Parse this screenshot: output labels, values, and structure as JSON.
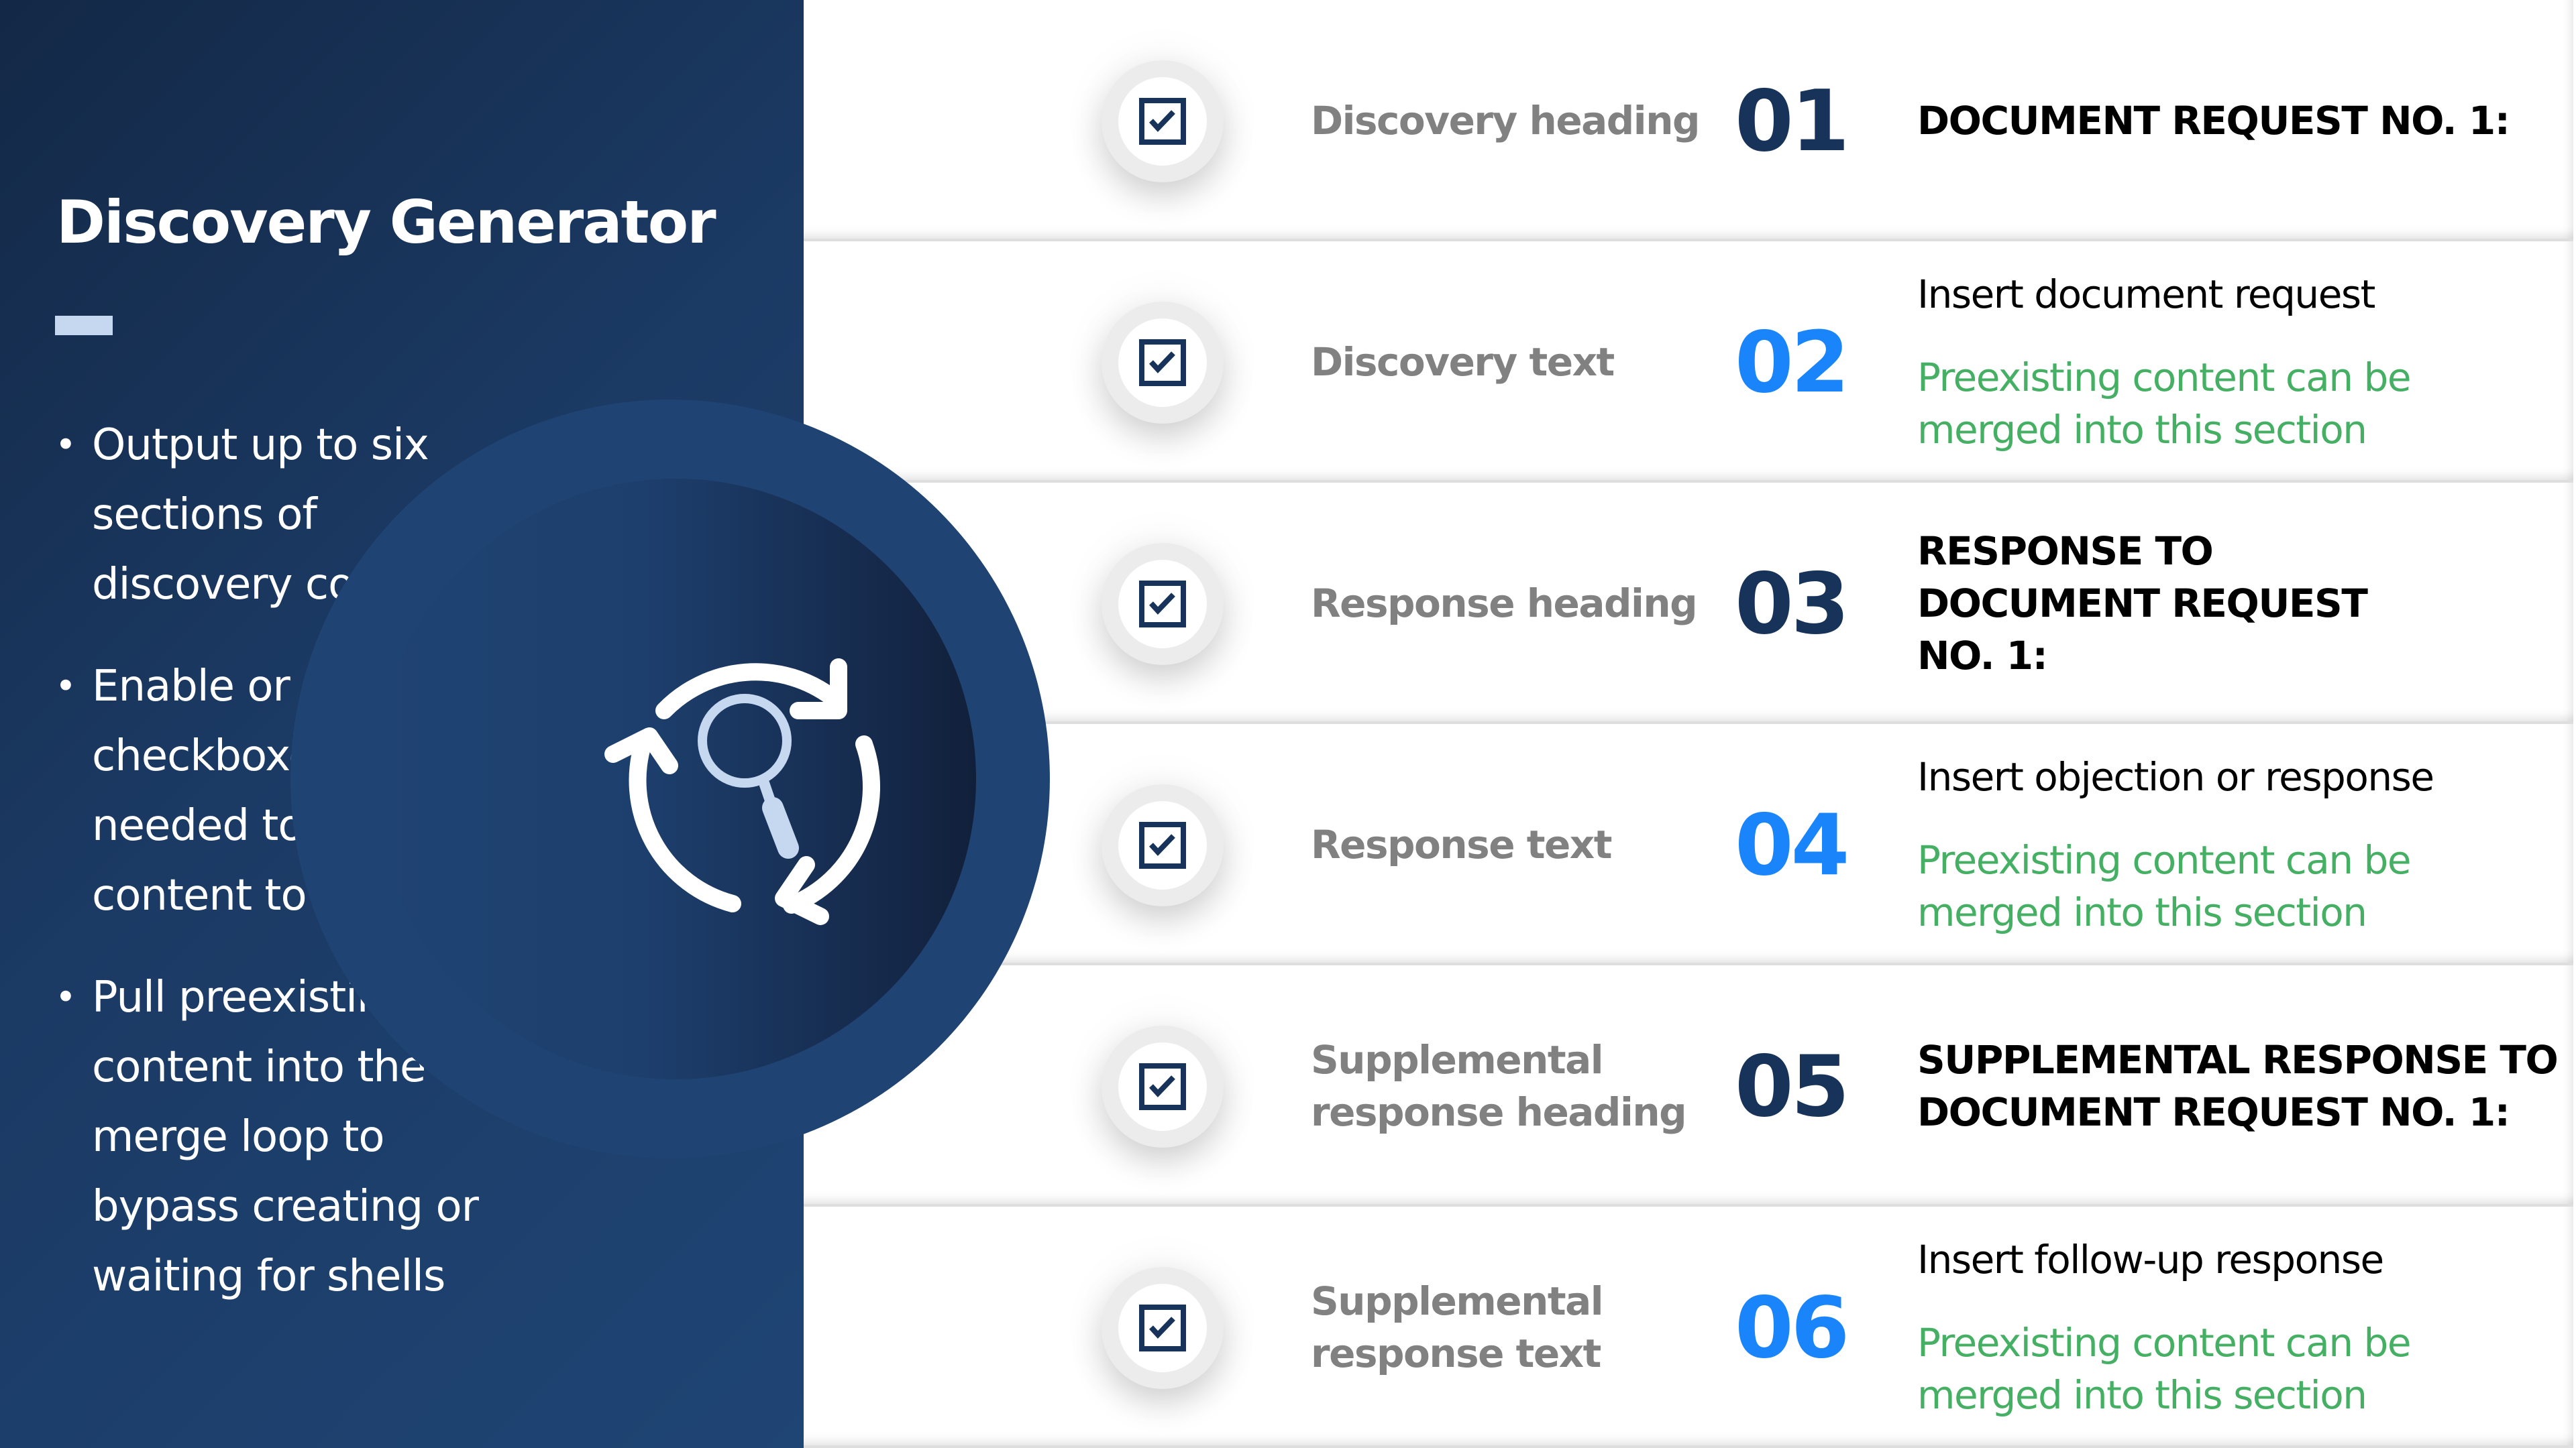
{
  "sidebar": {
    "title": "Discovery Generator",
    "bullets": [
      "Output up to six sections of discovery content",
      "Enable or disable checkboxes as needed to select content to output",
      "Pull preexisting content into the merge loop to bypass creating or waiting for shells"
    ],
    "icon": "cycle-search-icon"
  },
  "sections": [
    {
      "number": "01",
      "label": "Discovery heading",
      "checked": true,
      "number_style": "dark",
      "heading": "DOCUMENT REQUEST NO. 1:",
      "body": "",
      "note": ""
    },
    {
      "number": "02",
      "label": "Discovery text",
      "checked": true,
      "number_style": "blue",
      "heading": "",
      "body": "Insert document request",
      "note": "Preexisting content can be merged into this section"
    },
    {
      "number": "03",
      "label": "Response heading",
      "checked": true,
      "number_style": "dark",
      "heading": "RESPONSE TO DOCUMENT REQUEST NO. 1:",
      "body": "",
      "note": ""
    },
    {
      "number": "04",
      "label": "Response text",
      "checked": true,
      "number_style": "blue",
      "heading": "",
      "body": "Insert objection or response",
      "note": "Preexisting content can be merged into this section"
    },
    {
      "number": "05",
      "label": "Supplemental response heading",
      "checked": true,
      "number_style": "dark",
      "heading": "SUPPLEMENTAL RESPONSE TO DOCUMENT REQUEST NO. 1:",
      "body": "",
      "note": ""
    },
    {
      "number": "06",
      "label": "Supplemental response text",
      "checked": true,
      "number_style": "blue",
      "heading": "",
      "body": "Insert follow-up response",
      "note": "Preexisting content can be merged into this section"
    }
  ],
  "colors": {
    "panel": "#1b3a64",
    "number_dark": "#17335a",
    "number_blue": "#1a84fb",
    "label_gray": "#818181",
    "note_green": "#45b063",
    "accent_bar": "#c5d8f0"
  }
}
